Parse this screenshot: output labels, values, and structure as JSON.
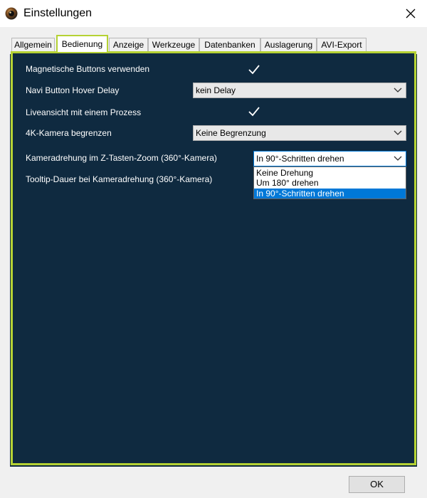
{
  "window": {
    "title": "Einstellungen"
  },
  "tabs": [
    {
      "label": "Allgemein",
      "active": false
    },
    {
      "label": "Bedienung",
      "active": true
    },
    {
      "label": "Anzeige",
      "active": false
    },
    {
      "label": "Werkzeuge",
      "active": false
    },
    {
      "label": "Datenbanken",
      "active": false
    },
    {
      "label": "Auslagerung",
      "active": false
    },
    {
      "label": "AVI-Export",
      "active": false
    }
  ],
  "settings": {
    "magnetic_buttons": {
      "label": "Magnetische Buttons verwenden",
      "checked": true
    },
    "navi_hover_delay": {
      "label": "Navi Button Hover Delay",
      "value": "kein Delay"
    },
    "live_view": {
      "label": "Liveansicht mit einem Prozess",
      "checked": true
    },
    "limit_4k": {
      "label": "4K-Kamera begrenzen",
      "value": "Keine Begrenzung"
    },
    "camera_rotation": {
      "label": "Kameradrehung im Z-Tasten-Zoom (360°-Kamera)",
      "value": "In 90°-Schritten drehen",
      "options": [
        "Keine Drehung",
        "Um 180° drehen",
        "In 90°-Schritten drehen"
      ],
      "selected_index": 2
    },
    "tooltip_duration": {
      "label": "Tooltip-Dauer bei Kameradrehung (360°-Kamera)"
    }
  },
  "footer": {
    "ok_label": "OK"
  },
  "colors": {
    "panel_bg": "#0f2a40",
    "accent_border": "#b5d234",
    "selection": "#0078d7",
    "chrome": "#f0f0f0"
  }
}
